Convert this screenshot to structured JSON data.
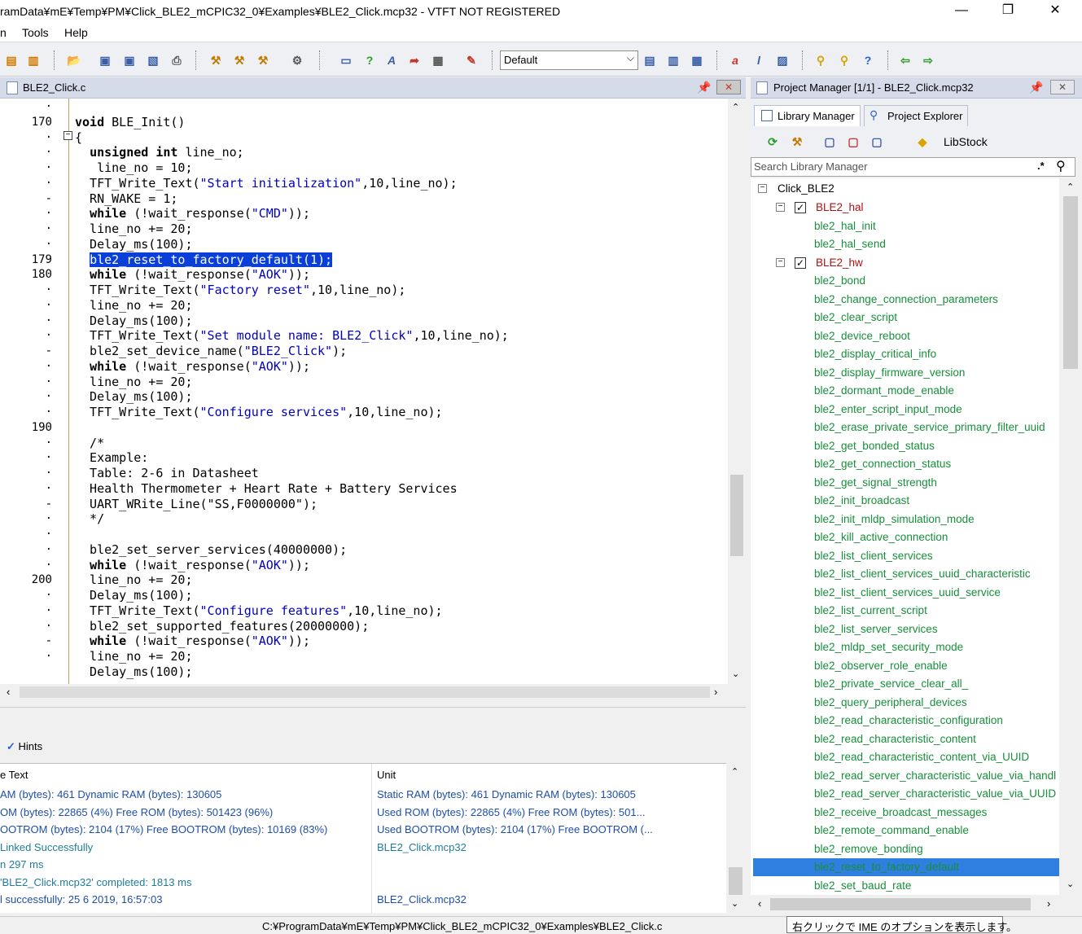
{
  "window": {
    "title": "ramData¥mE¥Temp¥PM¥Click_BLE2_mCPIC32_0¥Examples¥BLE2_Click.mcp32 - VTFT NOT REGISTERED",
    "minimize": "—",
    "restore": "❐",
    "close": "✕"
  },
  "menu": {
    "items": [
      "n",
      "Tools",
      "Help"
    ]
  },
  "toolbar": {
    "combo_value": "Default"
  },
  "editor": {
    "tab_title": "BLE2_Click.c",
    "line_numbers": [
      "·",
      "170",
      "·",
      "·",
      "·",
      "·",
      "-",
      "·",
      "·",
      "·",
      "179",
      "180",
      "·",
      "·",
      "·",
      "·",
      "-",
      "·",
      "·",
      "·",
      "·",
      "190",
      "·",
      "·",
      "·",
      "·",
      "-",
      "·",
      "·",
      "·",
      "·",
      "200",
      "·",
      "·",
      "·",
      "-",
      "·"
    ],
    "lines": [
      [
        {
          "t": ""
        }
      ],
      [
        {
          "t": "void",
          "c": "kw"
        },
        {
          "t": " BLE_Init()"
        }
      ],
      [
        {
          "t": "{"
        }
      ],
      [
        {
          "t": "  "
        },
        {
          "t": "unsigned int",
          "c": "kw"
        },
        {
          "t": " line_no;"
        }
      ],
      [
        {
          "t": "   line_no = 10;"
        }
      ],
      [
        {
          "t": "  TFT_Write_Text("
        },
        {
          "t": "\"Start initialization\"",
          "c": "str"
        },
        {
          "t": ",10,line_no);"
        }
      ],
      [
        {
          "t": "  RN_WAKE = 1;"
        }
      ],
      [
        {
          "t": "  "
        },
        {
          "t": "while",
          "c": "kw"
        },
        {
          "t": " (!wait_response("
        },
        {
          "t": "\"CMD\"",
          "c": "str"
        },
        {
          "t": "));"
        }
      ],
      [
        {
          "t": "  line_no += 20;"
        }
      ],
      [
        {
          "t": "  Delay_ms(100);"
        }
      ],
      [
        {
          "t": "  "
        },
        {
          "t": "ble2_reset_to_factory_default(1);",
          "c": "sel"
        }
      ],
      [
        {
          "t": "  "
        },
        {
          "t": "while",
          "c": "kw"
        },
        {
          "t": " (!wait_response("
        },
        {
          "t": "\"AOK\"",
          "c": "str"
        },
        {
          "t": "));"
        }
      ],
      [
        {
          "t": "  TFT_Write_Text("
        },
        {
          "t": "\"Factory reset\"",
          "c": "str"
        },
        {
          "t": ",10,line_no);"
        }
      ],
      [
        {
          "t": "  line_no += 20;"
        }
      ],
      [
        {
          "t": "  Delay_ms(100);"
        }
      ],
      [
        {
          "t": "  TFT_Write_Text("
        },
        {
          "t": "\"Set module name: BLE2_Click\"",
          "c": "str"
        },
        {
          "t": ",10,line_no);"
        }
      ],
      [
        {
          "t": "  ble2_set_device_name("
        },
        {
          "t": "\"BLE2_Click\"",
          "c": "str"
        },
        {
          "t": ");"
        }
      ],
      [
        {
          "t": "  "
        },
        {
          "t": "while",
          "c": "kw"
        },
        {
          "t": " (!wait_response("
        },
        {
          "t": "\"AOK\"",
          "c": "str"
        },
        {
          "t": "));"
        }
      ],
      [
        {
          "t": "  line_no += 20;"
        }
      ],
      [
        {
          "t": "  Delay_ms(100);"
        }
      ],
      [
        {
          "t": "  TFT_Write_Text("
        },
        {
          "t": "\"Configure services\"",
          "c": "str"
        },
        {
          "t": ",10,line_no);"
        }
      ],
      [
        {
          "t": ""
        }
      ],
      [
        {
          "t": "  /*"
        }
      ],
      [
        {
          "t": "  Example:"
        }
      ],
      [
        {
          "t": "  Table: 2-6 in Datasheet"
        }
      ],
      [
        {
          "t": "  Health Thermometer + Heart Rate + Battery Services"
        }
      ],
      [
        {
          "t": "  UART_WRite_Line(\"SS,F0000000\");"
        }
      ],
      [
        {
          "t": "  */"
        }
      ],
      [
        {
          "t": ""
        }
      ],
      [
        {
          "t": "  ble2_set_server_services(40000000);"
        }
      ],
      [
        {
          "t": "  "
        },
        {
          "t": "while",
          "c": "kw"
        },
        {
          "t": " (!wait_response("
        },
        {
          "t": "\"AOK\"",
          "c": "str"
        },
        {
          "t": "));"
        }
      ],
      [
        {
          "t": "  line_no += 20;"
        }
      ],
      [
        {
          "t": "  Delay_ms(100);"
        }
      ],
      [
        {
          "t": "  TFT_Write_Text("
        },
        {
          "t": "\"Configure features\"",
          "c": "str"
        },
        {
          "t": ",10,line_no);"
        }
      ],
      [
        {
          "t": "  ble2_set_supported_features(20000000);"
        }
      ],
      [
        {
          "t": "  "
        },
        {
          "t": "while",
          "c": "kw"
        },
        {
          "t": " (!wait_response("
        },
        {
          "t": "\"AOK\"",
          "c": "str"
        },
        {
          "t": "));"
        }
      ],
      [
        {
          "t": "  line_no += 20;"
        }
      ],
      [
        {
          "t": "  Delay_ms(100);"
        }
      ]
    ]
  },
  "messages": {
    "hints_label": "Hints",
    "col_text": "e Text",
    "col_unit": "Unit",
    "rows": [
      {
        "text": "AM (bytes): 461   Dynamic RAM (bytes): 130605",
        "unit": "Static RAM (bytes): 461   Dynamic RAM (bytes): 130605",
        "style": "m-blue"
      },
      {
        "text": "OM (bytes): 22865 (4%)  Free ROM (bytes): 501423 (96%)",
        "unit": "Used ROM (bytes): 22865 (4%)  Free ROM (bytes): 501...",
        "style": "m-blue"
      },
      {
        "text": "OOTROM (bytes): 2104 (17%)  Free BOOTROM (bytes): 10169 (83%)",
        "unit": "Used BOOTROM (bytes): 2104 (17%)  Free BOOTROM (...",
        "style": "m-blue"
      },
      {
        "text": "Linked Successfully",
        "unit": "BLE2_Click.mcp32",
        "style": "m-teal"
      },
      {
        "text": "n 297 ms",
        "unit": "",
        "style": "m-teal"
      },
      {
        "text": "'BLE2_Click.mcp32' completed: 1813 ms",
        "unit": "",
        "style": "m-teal"
      },
      {
        "text": "l successfully: 25 6 2019, 16:57:03",
        "unit": "BLE2_Click.mcp32",
        "style": "m-blue"
      }
    ]
  },
  "project_manager": {
    "title": "Project Manager [1/1] - BLE2_Click.mcp32",
    "tabs": [
      "Library Manager",
      "Project Explorer"
    ],
    "libstock": "LibStock",
    "search_placeholder": "Search Library Manager",
    "root": "Click_BLE2",
    "tree": [
      {
        "label": "BLE2_hal",
        "type": "lib"
      },
      {
        "label": "ble2_hal_init",
        "type": "fn"
      },
      {
        "label": "ble2_hal_send",
        "type": "fn"
      },
      {
        "label": "BLE2_hw",
        "type": "lib"
      },
      {
        "label": "ble2_bond",
        "type": "fn"
      },
      {
        "label": "ble2_change_connection_parameters",
        "type": "fn"
      },
      {
        "label": "ble2_clear_script",
        "type": "fn"
      },
      {
        "label": "ble2_device_reboot",
        "type": "fn"
      },
      {
        "label": "ble2_display_critical_info",
        "type": "fn"
      },
      {
        "label": "ble2_display_firmware_version",
        "type": "fn"
      },
      {
        "label": "ble2_dormant_mode_enable",
        "type": "fn"
      },
      {
        "label": "ble2_enter_script_input_mode",
        "type": "fn"
      },
      {
        "label": "ble2_erase_private_service_primary_filter_uuid",
        "type": "fn"
      },
      {
        "label": "ble2_get_bonded_status",
        "type": "fn"
      },
      {
        "label": "ble2_get_connection_status",
        "type": "fn"
      },
      {
        "label": "ble2_get_signal_strength",
        "type": "fn"
      },
      {
        "label": "ble2_init_broadcast",
        "type": "fn"
      },
      {
        "label": "ble2_init_mldp_simulation_mode",
        "type": "fn"
      },
      {
        "label": "ble2_kill_active_connection",
        "type": "fn"
      },
      {
        "label": "ble2_list_client_services",
        "type": "fn"
      },
      {
        "label": "ble2_list_client_services_uuid_characteristic",
        "type": "fn"
      },
      {
        "label": "ble2_list_client_services_uuid_service",
        "type": "fn"
      },
      {
        "label": "ble2_list_current_script",
        "type": "fn"
      },
      {
        "label": "ble2_list_server_services",
        "type": "fn"
      },
      {
        "label": "ble2_mldp_set_security_mode",
        "type": "fn"
      },
      {
        "label": "ble2_observer_role_enable",
        "type": "fn"
      },
      {
        "label": "ble2_private_service_clear_all_",
        "type": "fn"
      },
      {
        "label": "ble2_query_peripheral_devices",
        "type": "fn"
      },
      {
        "label": "ble2_read_characteristic_configuration",
        "type": "fn"
      },
      {
        "label": "ble2_read_characteristic_content",
        "type": "fn"
      },
      {
        "label": "ble2_read_characteristic_content_via_UUID",
        "type": "fn"
      },
      {
        "label": "ble2_read_server_characteristic_value_via_handl",
        "type": "fn"
      },
      {
        "label": "ble2_read_server_characteristic_value_via_UUID",
        "type": "fn"
      },
      {
        "label": "ble2_receive_broadcast_messages",
        "type": "fn"
      },
      {
        "label": "ble2_remote_command_enable",
        "type": "fn"
      },
      {
        "label": "ble2_remove_bonding",
        "type": "fn"
      },
      {
        "label": "ble2_reset_to_factory_default",
        "type": "fn",
        "selected": true
      },
      {
        "label": "ble2_set_baud_rate",
        "type": "fn"
      }
    ]
  },
  "statusbar": {
    "path": "C:¥ProgramData¥mE¥Temp¥PM¥Click_BLE2_mCPIC32_0¥Examples¥BLE2_Click.c",
    "tooltip": "右クリックで IME のオプションを表示します。"
  },
  "icons": {
    "editor_close": "close-icon",
    "pin": "pin-icon",
    "search": "search-icon",
    "regex": ".*"
  }
}
